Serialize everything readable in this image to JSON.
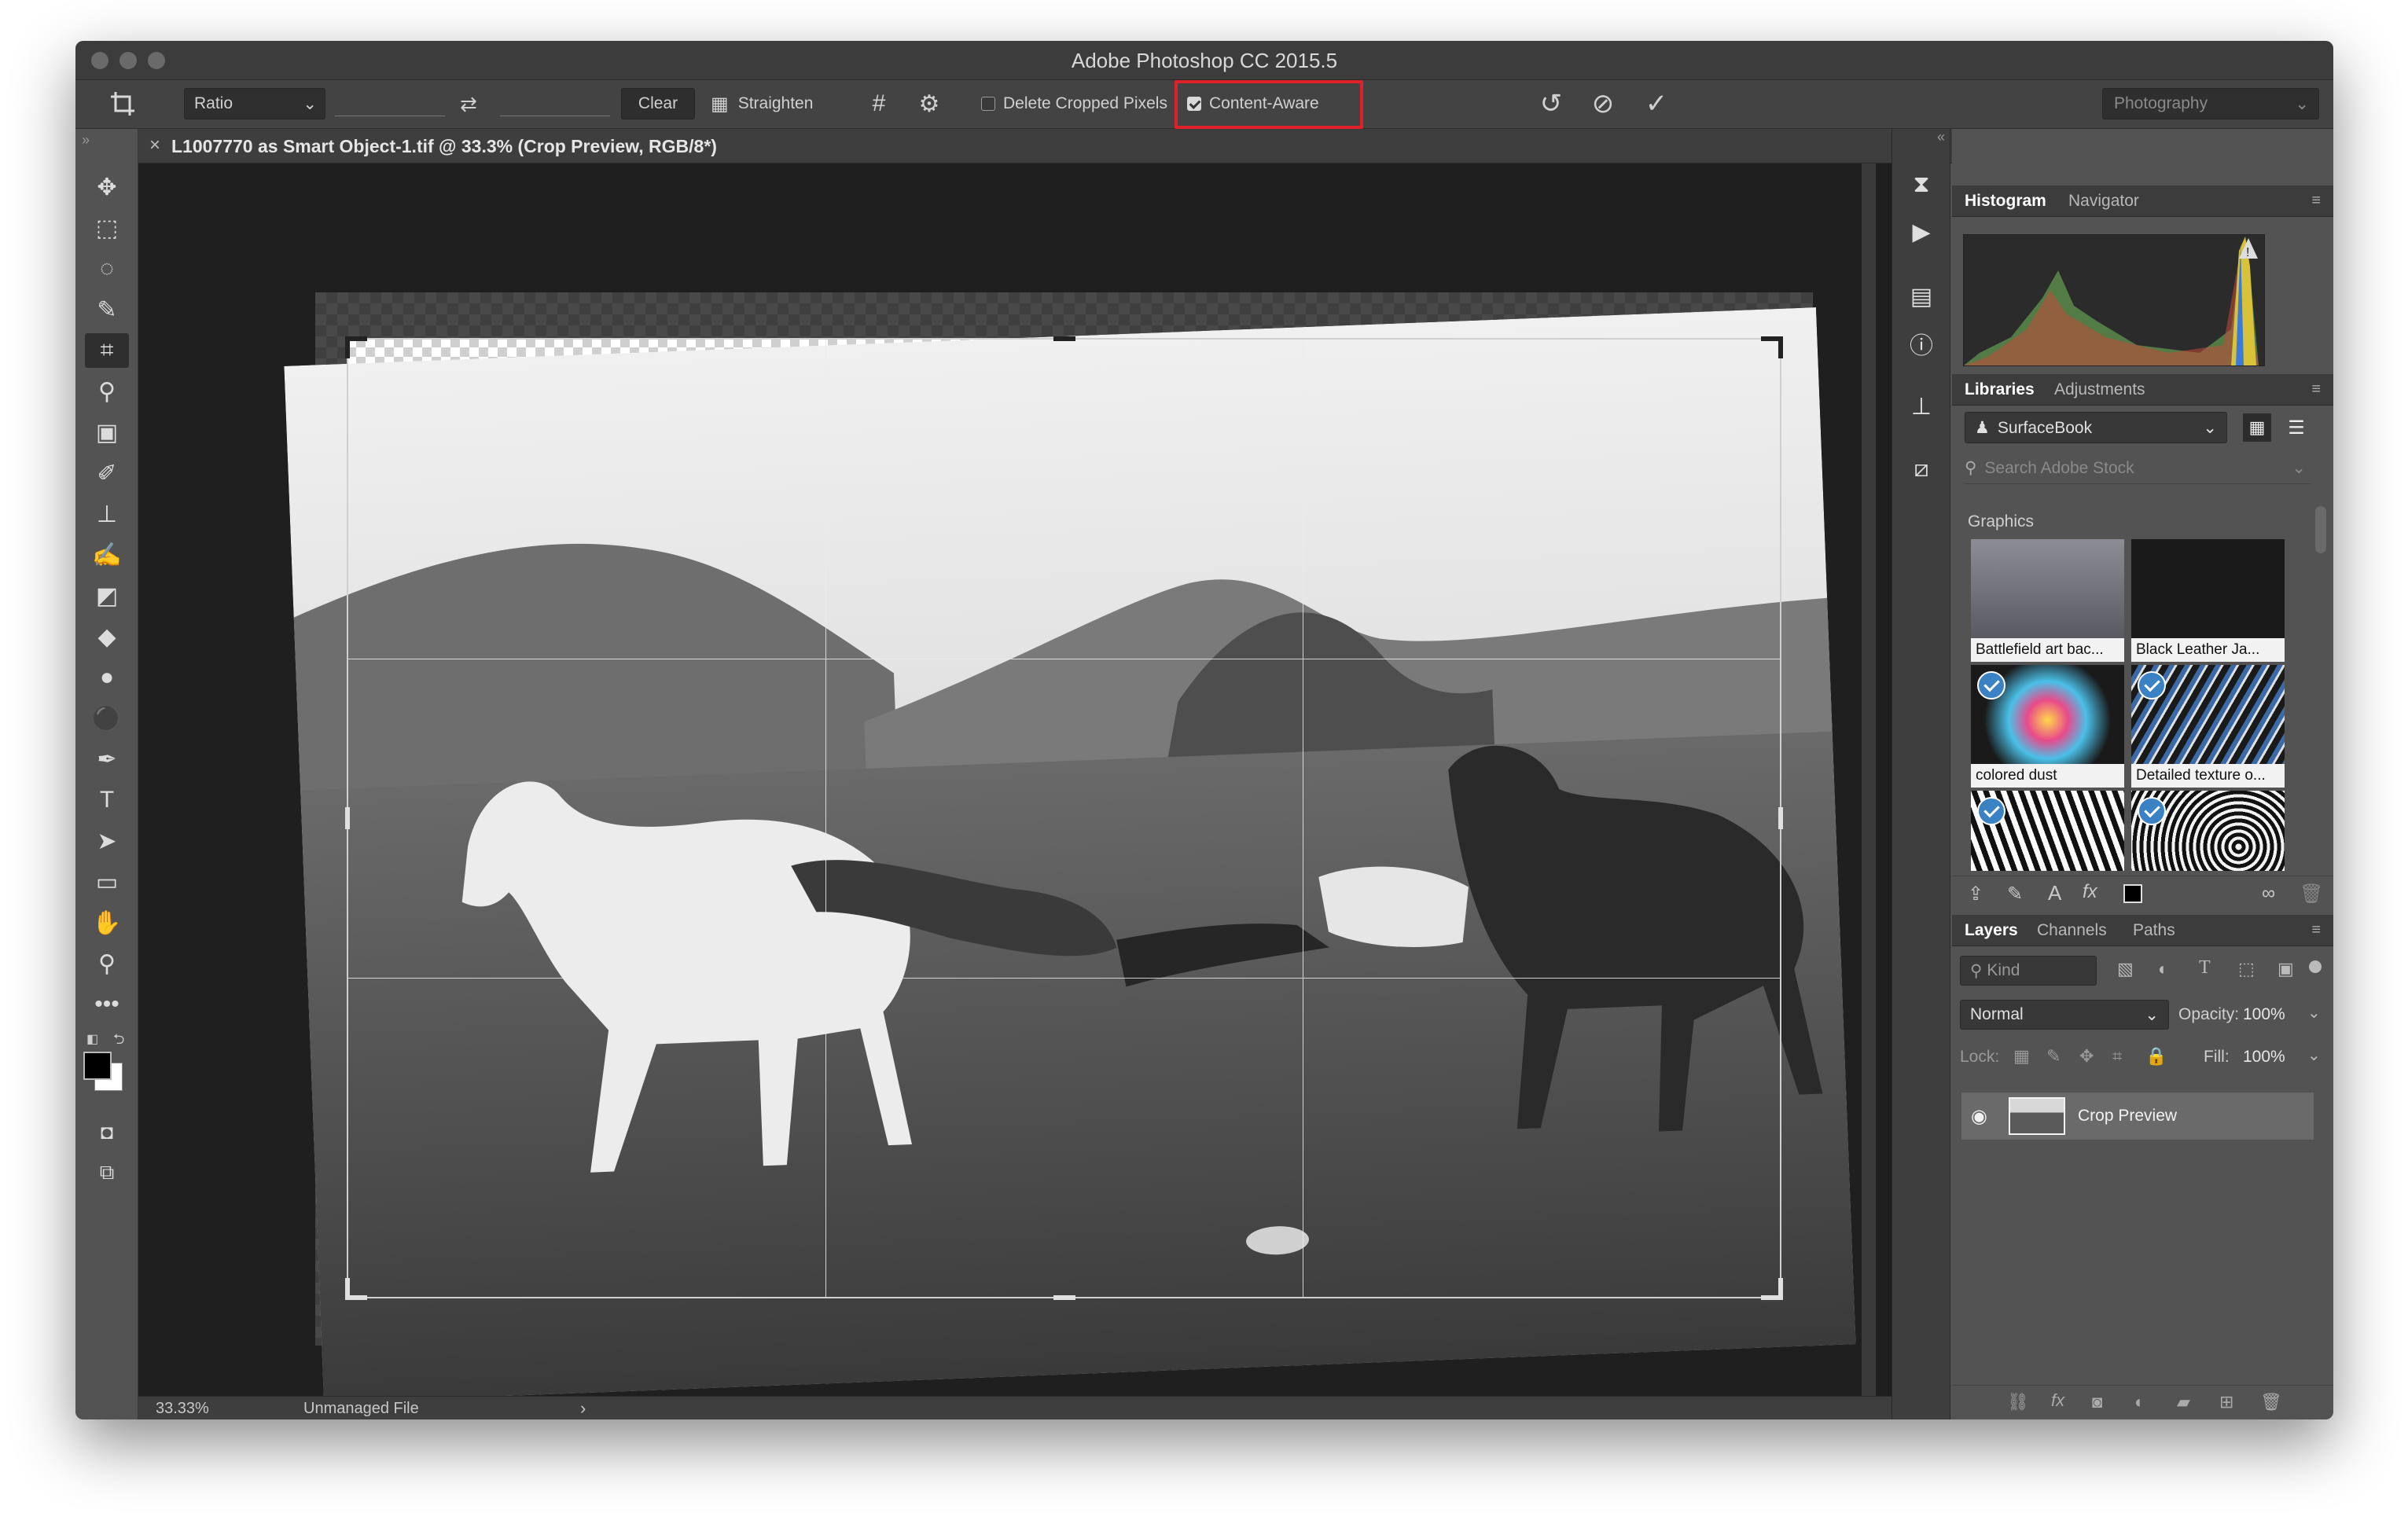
{
  "window": {
    "title": "Adobe Photoshop CC 2015.5"
  },
  "options_bar": {
    "ratio_label": "Ratio",
    "clear_label": "Clear",
    "straighten_label": "Straighten",
    "delete_cropped_label": "Delete Cropped Pixels",
    "delete_cropped_checked": false,
    "content_aware_label": "Content-Aware",
    "content_aware_checked": true,
    "workspace_label": "Photography"
  },
  "document": {
    "tab_label": "L1007770 as Smart Object-1.tif @ 33.3% (Crop Preview, RGB/8*)",
    "close_symbol": "×"
  },
  "status": {
    "zoom": "33.33%",
    "file_info": "Unmanaged File",
    "arrow": "›"
  },
  "panels": {
    "histogram_tabs": [
      "Histogram",
      "Navigator"
    ],
    "libraries_tabs": [
      "Libraries",
      "Adjustments"
    ],
    "library_name": "SurfaceBook",
    "search_placeholder": "Search Adobe Stock",
    "graphics_heading": "Graphics",
    "graphics": [
      {
        "caption": "Battlefield art bac...",
        "licensed": false
      },
      {
        "caption": "Black Leather Ja...",
        "licensed": false
      },
      {
        "caption": "colored dust",
        "licensed": true
      },
      {
        "caption": "Detailed texture o...",
        "licensed": true
      },
      {
        "caption": "",
        "licensed": true
      },
      {
        "caption": "",
        "licensed": true
      }
    ],
    "layers_tabs": [
      "Layers",
      "Channels",
      "Paths"
    ],
    "kind_label": "Kind",
    "blend_mode": "Normal",
    "opacity_label": "Opacity:",
    "opacity_value": "100%",
    "lock_label": "Lock:",
    "fill_label": "Fill:",
    "fill_value": "100%",
    "layer_name": "Crop Preview"
  },
  "colors": {
    "highlight": "#e0212a",
    "accent": "#3b82c4"
  }
}
